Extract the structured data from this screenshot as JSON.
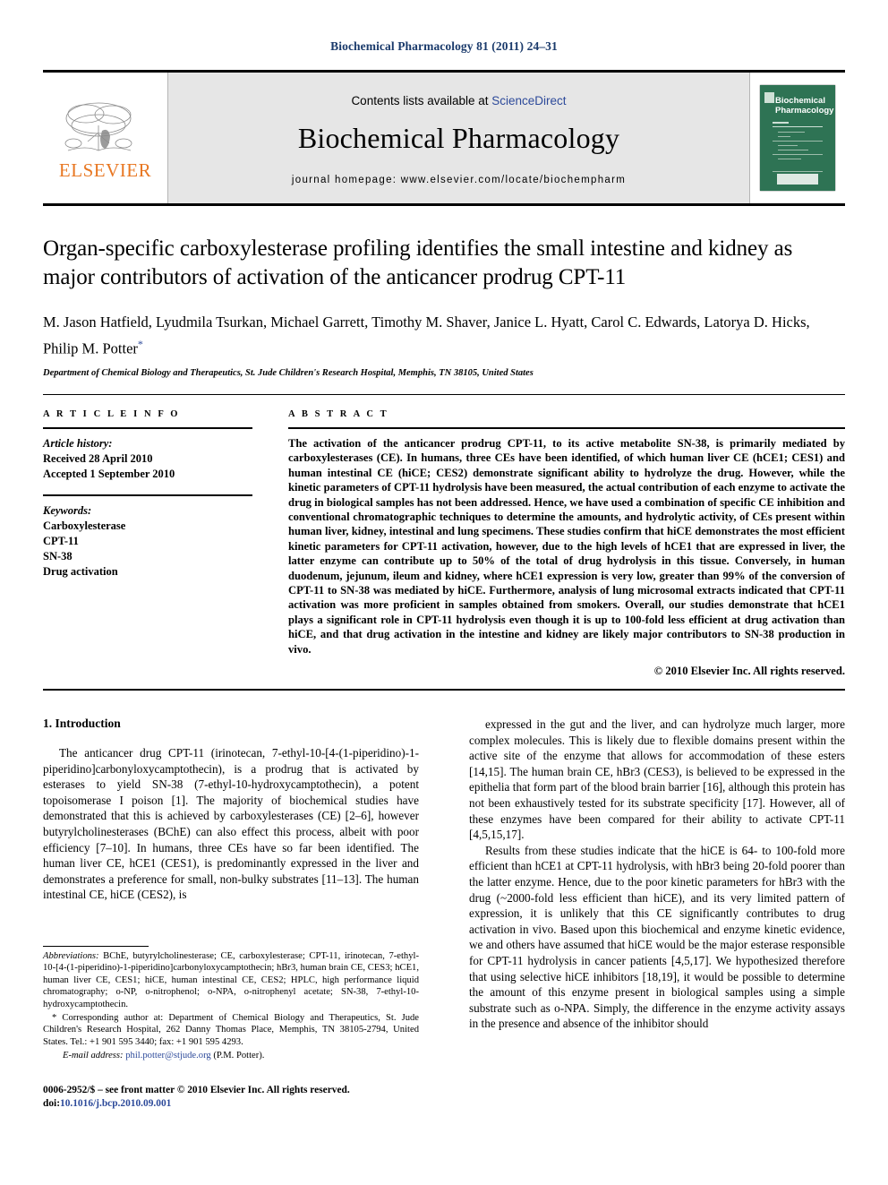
{
  "running_head": "Biochemical Pharmacology 81 (2011) 24–31",
  "banner": {
    "publisher_logo_text": "ELSEVIER",
    "contents_prefix": "Contents lists available at ",
    "contents_link": "ScienceDirect",
    "journal_name": "Biochemical Pharmacology",
    "homepage": "journal homepage: www.elsevier.com/locate/biochempharm",
    "cover_title_line1": "Biochemical",
    "cover_title_line2": "Pharmacology"
  },
  "article": {
    "title": "Organ-specific carboxylesterase profiling identifies the small intestine and kidney as major contributors of activation of the anticancer prodrug CPT-11",
    "authors": "M. Jason Hatfield, Lyudmila Tsurkan, Michael Garrett, Timothy M. Shaver, Janice L. Hyatt, Carol C. Edwards, Latorya D. Hicks, Philip M. Potter",
    "corresponding_marker": "*",
    "affiliation": "Department of Chemical Biology and Therapeutics, St. Jude Children's Research Hospital, Memphis, TN 38105, United States"
  },
  "article_info": {
    "heading": "A R T I C L E   I N F O",
    "history_label": "Article history:",
    "received": "Received 28 April 2010",
    "accepted": "Accepted 1 September 2010",
    "keywords_label": "Keywords:",
    "keywords": [
      "Carboxylesterase",
      "CPT-11",
      "SN-38",
      "Drug activation"
    ]
  },
  "abstract": {
    "heading": "A B S T R A C T",
    "text": "The activation of the anticancer prodrug CPT-11, to its active metabolite SN-38, is primarily mediated by carboxylesterases (CE). In humans, three CEs have been identified, of which human liver CE (hCE1; CES1) and human intestinal CE (hiCE; CES2) demonstrate significant ability to hydrolyze the drug. However, while the kinetic parameters of CPT-11 hydrolysis have been measured, the actual contribution of each enzyme to activate the drug in biological samples has not been addressed. Hence, we have used a combination of specific CE inhibition and conventional chromatographic techniques to determine the amounts, and hydrolytic activity, of CEs present within human liver, kidney, intestinal and lung specimens. These studies confirm that hiCE demonstrates the most efficient kinetic parameters for CPT-11 activation, however, due to the high levels of hCE1 that are expressed in liver, the latter enzyme can contribute up to 50% of the total of drug hydrolysis in this tissue. Conversely, in human duodenum, jejunum, ileum and kidney, where hCE1 expression is very low, greater than 99% of the conversion of CPT-11 to SN-38 was mediated by hiCE. Furthermore, analysis of lung microsomal extracts indicated that CPT-11 activation was more proficient in samples obtained from smokers. Overall, our studies demonstrate that hCE1 plays a significant role in CPT-11 hydrolysis even though it is up to 100-fold less efficient at drug activation than hiCE, and that drug activation in the intestine and kidney are likely major contributors to SN-38 production in vivo.",
    "copyright": "© 2010 Elsevier Inc. All rights reserved."
  },
  "introduction": {
    "heading": "1. Introduction",
    "left_paragraph": "The anticancer drug CPT-11 (irinotecan, 7-ethyl-10-[4-(1-piperidino)-1-piperidino]carbonyloxycamptothecin), is a prodrug that is activated by esterases to yield SN-38 (7-ethyl-10-hydroxycamptothecin), a potent topoisomerase I poison [1]. The majority of biochemical studies have demonstrated that this is achieved by carboxylesterases (CE) [2–6], however butyrylcholinesterases (BChE) can also effect this process, albeit with poor efficiency [7–10]. In humans, three CEs have so far been identified. The human liver CE, hCE1 (CES1), is predominantly expressed in the liver and demonstrates a preference for small, non-bulky substrates [11–13]. The human intestinal CE, hiCE (CES2), is",
    "right_paragraph_1": "expressed in the gut and the liver, and can hydrolyze much larger, more complex molecules. This is likely due to flexible domains present within the active site of the enzyme that allows for accommodation of these esters [14,15]. The human brain CE, hBr3 (CES3), is believed to be expressed in the epithelia that form part of the blood brain barrier [16], although this protein has not been exhaustively tested for its substrate specificity [17]. However, all of these enzymes have been compared for their ability to activate CPT-11 [4,5,15,17].",
    "right_paragraph_2": "Results from these studies indicate that the hiCE is 64- to 100-fold more efficient than hCE1 at CPT-11 hydrolysis, with hBr3 being 20-fold poorer than the latter enzyme. Hence, due to the poor kinetic parameters for hBr3 with the drug (~2000-fold less efficient than hiCE), and its very limited pattern of expression, it is unlikely that this CE significantly contributes to drug activation in vivo. Based upon this biochemical and enzyme kinetic evidence, we and others have assumed that hiCE would be the major esterase responsible for CPT-11 hydrolysis in cancer patients [4,5,17]. We hypothesized therefore that using selective hiCE inhibitors [18,19], it would be possible to determine the amount of this enzyme present in biological samples using a simple substrate such as o-NPA. Simply, the difference in the enzyme activity assays in the presence and absence of the inhibitor should"
  },
  "footnotes": {
    "abbreviations_label": "Abbreviations:",
    "abbreviations_text": " BChE, butyrylcholinesterase; CE, carboxylesterase; CPT-11, irinotecan, 7-ethyl-10-[4-(1-piperidino)-1-piperidino]carbonyloxycamptothecin; hBr3, human brain CE, CES3; hCE1, human liver CE, CES1; hiCE, human intestinal CE, CES2; HPLC, high performance liquid chromatography; o-NP, o-nitrophenol; o-NPA, o-nitrophenyl acetate; SN-38, 7-ethyl-10-hydroxycamptothecin.",
    "corresponding_marker": "*",
    "corresponding_text": " Corresponding author at: Department of Chemical Biology and Therapeutics, St. Jude Children's Research Hospital, 262 Danny Thomas Place, Memphis, TN 38105-2794, United States. Tel.: +1 901 595 3440; fax: +1 901 595 4293.",
    "email_label": "E-mail address:",
    "email": "phil.potter@stjude.org",
    "email_suffix": " (P.M. Potter)."
  },
  "page_footer": {
    "front_matter": "0006-2952/$ – see front matter © 2010 Elsevier Inc. All rights reserved.",
    "doi_prefix": "doi:",
    "doi": "10.1016/j.bcp.2010.09.001"
  },
  "colors": {
    "link_blue": "#2d4a9a",
    "header_blue": "#1a3a6b",
    "elsevier_orange": "#e87722",
    "cover_green": "#2e7354"
  }
}
